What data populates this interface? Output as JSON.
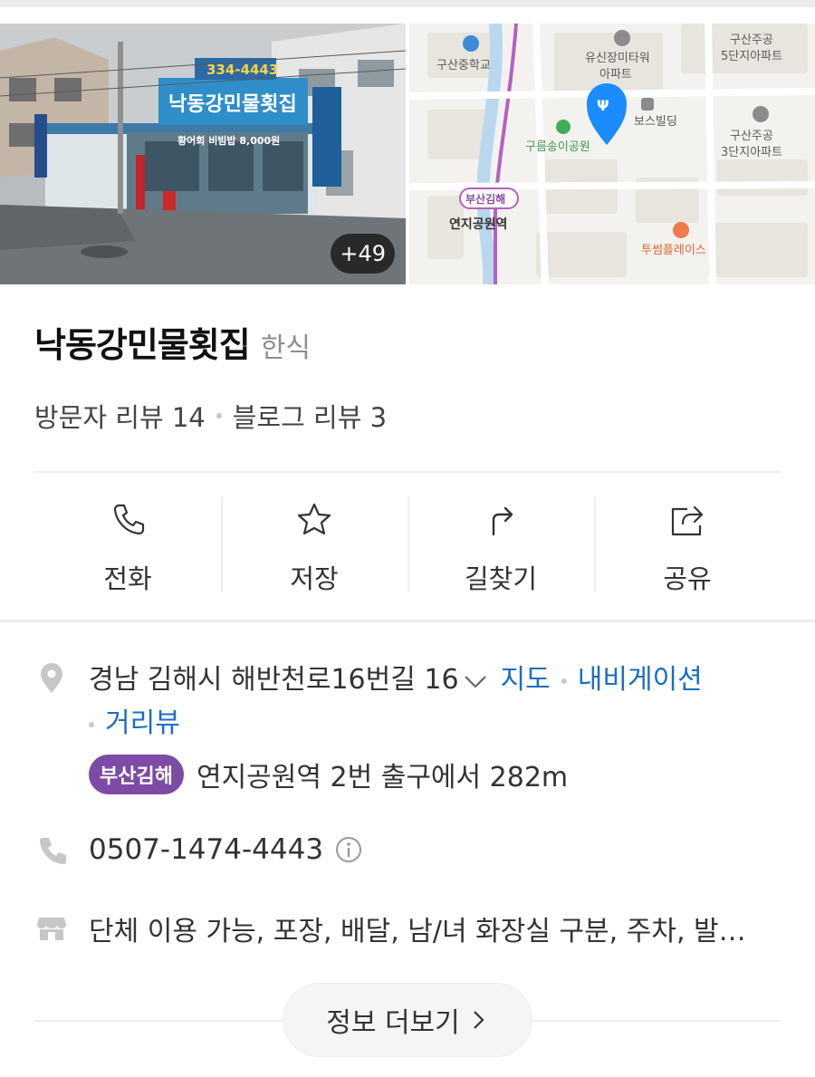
{
  "photos": {
    "more_count": "+49",
    "sign_phone": "334-4443",
    "sign_name": "낙동강민물횟집",
    "sign_menu": "황어회 비빔밥 8,000원"
  },
  "map": {
    "labels": {
      "school": "구산중학교",
      "apt1_line1": "유신장미타워",
      "apt1_line2": "아파트",
      "apt2_line1": "구산주공",
      "apt2_line2": "5단지아파트",
      "bldg": "보스빌딩",
      "apt3_line1": "구산주공",
      "apt3_line2": "3단지아파트",
      "park": "구름송이공원",
      "line_name": "부산김해",
      "station": "연지공원역",
      "place": "투썸플레이스"
    }
  },
  "place": {
    "name": "낙동강민물횟집",
    "category": "한식",
    "visitor_reviews": "방문자 리뷰 14",
    "blog_reviews": "블로그 리뷰 3"
  },
  "actions": [
    {
      "label": "전화",
      "icon": "phone-icon"
    },
    {
      "label": "저장",
      "icon": "star-icon"
    },
    {
      "label": "길찾기",
      "icon": "directions-icon"
    },
    {
      "label": "공유",
      "icon": "share-icon"
    }
  ],
  "info": {
    "address": "경남 김해시 해반천로16번길 16",
    "map_link": "지도",
    "nav_link": "내비게이션",
    "street_link": "거리뷰",
    "subway_line": "부산김해",
    "subway_text": "연지공원역 2번 출구에서 282m",
    "phone": "0507-1474-4443",
    "amenities": "단체 이용 가능, 포장, 배달, 남/녀 화장실 구분, 주차, 발…",
    "more_label": "정보 더보기"
  },
  "colors": {
    "link": "#1b6ec2",
    "subway_line": "#7d4aa6",
    "map_pin": "#1a8cff"
  }
}
